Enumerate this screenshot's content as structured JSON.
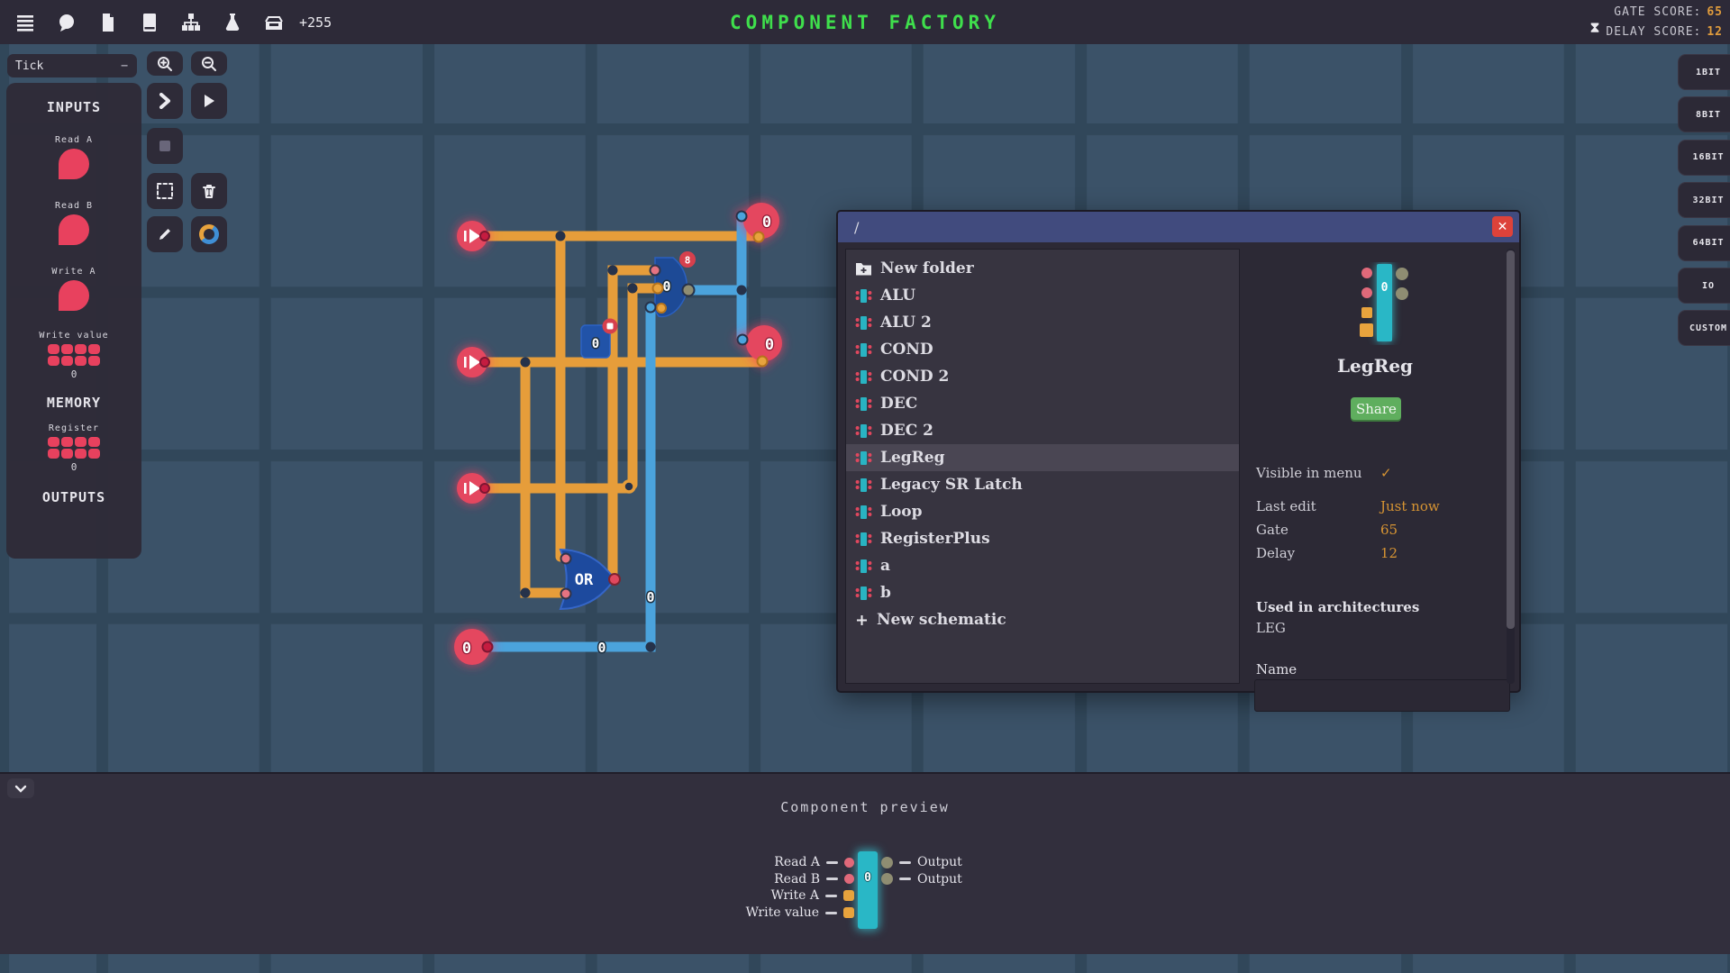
{
  "topbar": {
    "title": "COMPONENT FACTORY",
    "plus_count": "+255",
    "gate_score_label": "GATE SCORE:",
    "gate_score": "65",
    "delay_score_label": "DELAY SCORE:",
    "delay_score": "12",
    "icons": [
      "menu",
      "chat",
      "file",
      "book",
      "hierarchy",
      "flask",
      "inbox"
    ]
  },
  "tick": {
    "label": "Tick",
    "minus": "−"
  },
  "left_panel": {
    "inputs_header": "INPUTS",
    "inputs": [
      {
        "label": "Read A"
      },
      {
        "label": "Read B"
      },
      {
        "label": "Write A"
      }
    ],
    "write_value_label": "Write value",
    "write_value": "0",
    "memory_header": "MEMORY",
    "register_label": "Register",
    "register_value": "0",
    "outputs_header": "OUTPUTS"
  },
  "toolbar": {
    "buttons": [
      "zoom-in",
      "zoom-out",
      "step",
      "play",
      "stop",
      "select",
      "delete",
      "edit",
      "color-wheel"
    ]
  },
  "bit_tabs": [
    {
      "label": "1BIT"
    },
    {
      "label": "8BIT"
    },
    {
      "label": "16BIT"
    },
    {
      "label": "32BIT"
    },
    {
      "label": "64BIT"
    },
    {
      "label": "IO"
    },
    {
      "label": "CUSTOM"
    }
  ],
  "canvas": {
    "or_label": "OR",
    "latch_value": "0",
    "latch_badge": "8",
    "register_value": "0",
    "wire_vertical_label": "0",
    "wire_horizontal_label": "0",
    "output_top_value": "0",
    "output_mid_value": "0",
    "output_bottom_value": "0"
  },
  "dialog": {
    "path": "/",
    "close_label": "✕",
    "selected_index": 7,
    "items": [
      {
        "label": "New folder",
        "icon": "folder-plus"
      },
      {
        "label": "ALU",
        "icon": "component"
      },
      {
        "label": "ALU 2",
        "icon": "component"
      },
      {
        "label": "COND",
        "icon": "component"
      },
      {
        "label": "COND 2",
        "icon": "component"
      },
      {
        "label": "DEC",
        "icon": "component"
      },
      {
        "label": "DEC 2",
        "icon": "component"
      },
      {
        "label": "LegReg",
        "icon": "component"
      },
      {
        "label": "Legacy SR Latch",
        "icon": "component"
      },
      {
        "label": "Loop",
        "icon": "component"
      },
      {
        "label": "RegisterPlus",
        "icon": "component"
      },
      {
        "label": "a",
        "icon": "component"
      },
      {
        "label": "b",
        "icon": "component"
      },
      {
        "label": "New schematic",
        "icon": "plus"
      }
    ],
    "detail": {
      "component_name": "LegReg",
      "component_value": "0",
      "share_label": "Share",
      "visible_label": "Visible in menu",
      "visible_checked": "✓",
      "stats": [
        {
          "label": "Last edit",
          "value": "Just now"
        },
        {
          "label": "Gate",
          "value": "65"
        },
        {
          "label": "Delay",
          "value": "12"
        }
      ],
      "used_header": "Used in architectures",
      "used_value": "LEG",
      "name_label": "Name",
      "name_value": ""
    }
  },
  "bottom_panel": {
    "title": "Component preview",
    "chip_value": "0",
    "left_pins": [
      {
        "label": "Read A",
        "shape": "circle"
      },
      {
        "label": "Read B",
        "shape": "circle"
      },
      {
        "label": "Write A",
        "shape": "square"
      },
      {
        "label": "Write value",
        "shape": "square"
      }
    ],
    "right_pins": [
      {
        "label": "Output"
      },
      {
        "label": "Output"
      }
    ]
  }
}
